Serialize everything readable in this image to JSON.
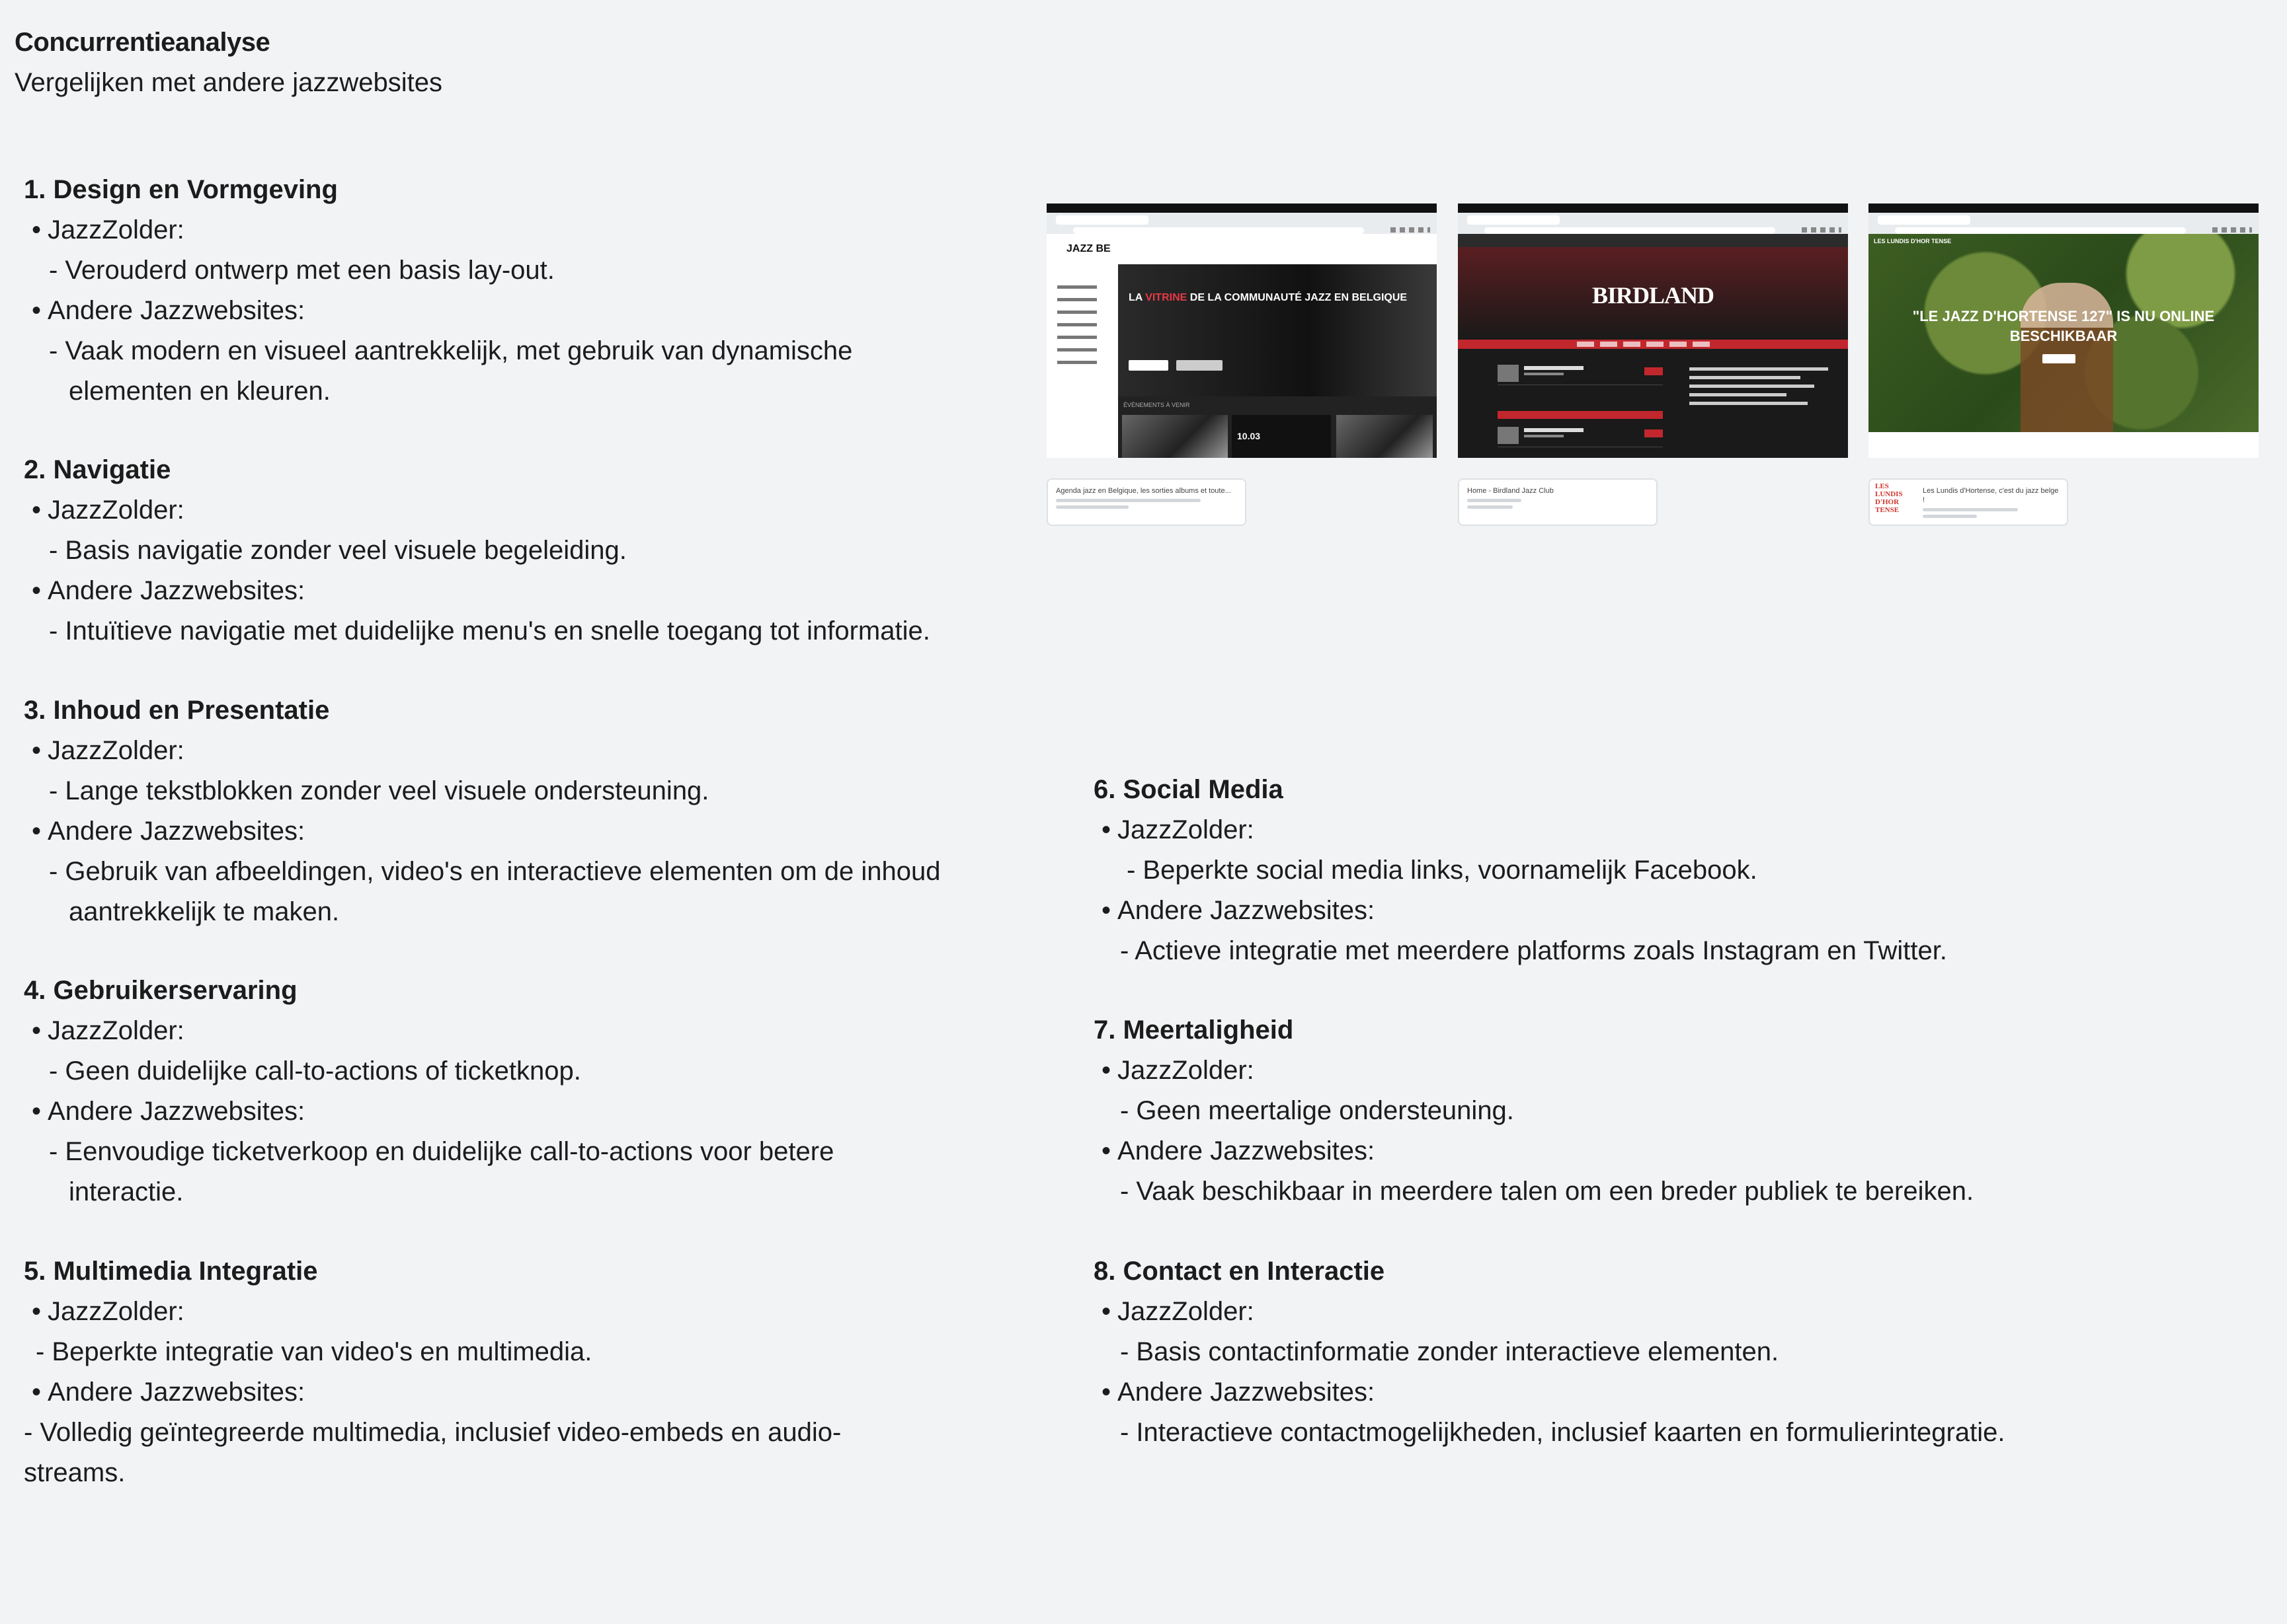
{
  "header": {
    "title": "Concurrentieanalyse",
    "subtitle": "Vergelijken met andere jazzwebsites"
  },
  "sections": [
    {
      "heading": "1. Design en Vormgeving",
      "jazz_label": "JazzZolder:",
      "jazz_text": "- Verouderd ontwerp met een basis lay-out.",
      "other_label": "Andere Jazzwebsites:",
      "other_text": "- Vaak modern en visueel aantrekkelijk, met gebruik van dynamische elementen en kleuren."
    },
    {
      "heading": "2. Navigatie",
      "jazz_label": "JazzZolder:",
      "jazz_text": "- Basis navigatie zonder veel visuele begeleiding.",
      "other_label": "Andere Jazzwebsites:",
      "other_text": "- Intuïtieve navigatie met duidelijke menu's en snelle toegang tot informatie."
    },
    {
      "heading": "3. Inhoud en Presentatie",
      "jazz_label": "JazzZolder:",
      "jazz_text": "- Lange tekstblokken zonder veel visuele ondersteuning.",
      "other_label": "Andere Jazzwebsites:",
      "other_text": "- Gebruik van afbeeldingen, video's en interactieve elementen om de inhoud aantrekkelijk te maken."
    },
    {
      "heading": "4. Gebruikerservaring",
      "jazz_label": "JazzZolder:",
      "jazz_text": "- Geen duidelijke call-to-actions of ticketknop.",
      "other_label": "Andere Jazzwebsites:",
      "other_text": "- Eenvoudige ticketverkoop en duidelijke call-to-actions voor betere interactie."
    },
    {
      "heading": "5. Multimedia Integratie",
      "jazz_label": "JazzZolder:",
      "jazz_text": "- Beperkte integratie van video's en multimedia.",
      "other_label": "Andere Jazzwebsites:",
      "other_text": "- Volledig geïntegreerde multimedia, inclusief video-embeds en audio-streams."
    },
    {
      "heading": "6. Social Media",
      "jazz_label": "JazzZolder:",
      "jazz_text": "- Beperkte social media links, voornamelijk Facebook.",
      "other_label": "Andere Jazzwebsites:",
      "other_text": "- Actieve integratie met meerdere platforms zoals Instagram en Twitter."
    },
    {
      "heading": "7. Meertaligheid",
      "jazz_label": "JazzZolder:",
      "jazz_text": "- Geen meertalige ondersteuning.",
      "other_label": "Andere Jazzwebsites:",
      "other_text": "- Vaak beschikbaar in meerdere talen om een breder publiek te bereiken."
    },
    {
      "heading": "8. Contact en Interactie",
      "jazz_label": "JazzZolder:",
      "jazz_text": "- Basis contactinformatie zonder interactieve elementen.",
      "other_label": "Andere Jazzwebsites:",
      "other_text": "- Interactieve contactmogelijkheden, inclusief kaarten en formulierintegratie."
    }
  ],
  "screenshots": [
    {
      "logo": "JAZZ BE",
      "hero_a": "LA ",
      "hero_accent": "VITRINE",
      "hero_b": " DE LA COMMUNAUTÉ JAZZ EN BELGIQUE",
      "strip_label": "ÉVÉNEMENTS À VENIR",
      "date": "10.03",
      "card_title": "Agenda jazz en Belgique, les sorties albums et toute...",
      "accent": "#e63946"
    },
    {
      "logo": "BIRDLAND",
      "card_title": "Home - Birdland Jazz Club",
      "accent": "#c1272d"
    },
    {
      "brand": "LES LUNDIS D'HOR TENSE",
      "hero_title": "\"LE JAZZ D'HORTENSE 127\" IS NU ONLINE BESCHIKBAAR",
      "card_title": "Les Lundis d'Hortense, c'est du jazz belge !",
      "card_logo": "LES LUNDIS D'HOR TENSE",
      "accent": "#d0342c"
    }
  ]
}
